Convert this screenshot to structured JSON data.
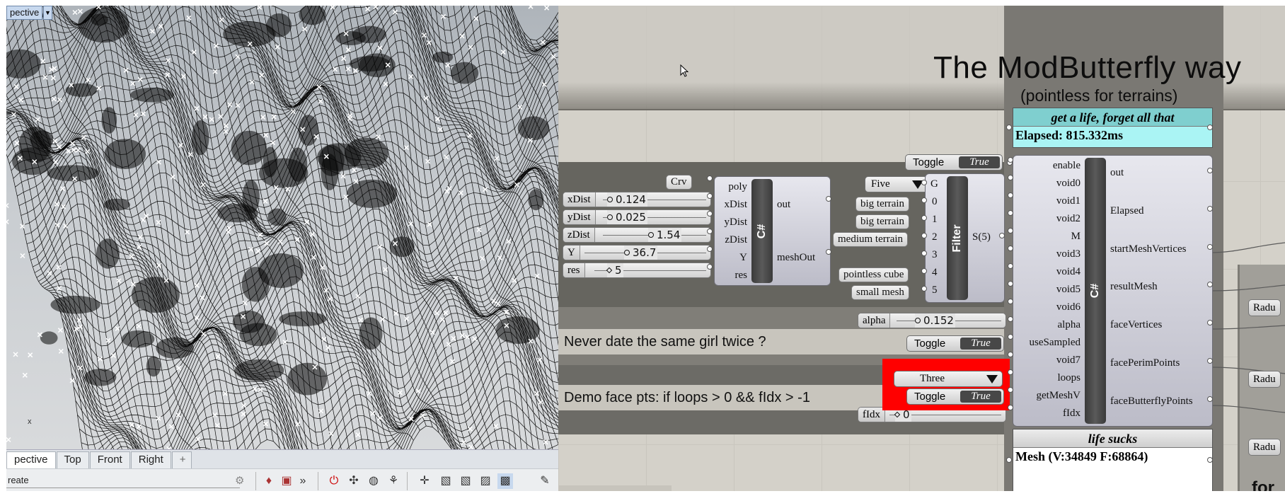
{
  "rhino": {
    "viewport_title": "pective",
    "tabs": [
      "pective",
      "Top",
      "Front",
      "Right"
    ],
    "tab_add_glyph": "+",
    "active_tab": "pective",
    "command_label": "reate",
    "axis_label": "x"
  },
  "grasshopper": {
    "title": "The ModButterfly way",
    "subtitle": "(pointless for terrains)",
    "notes": {
      "date": "Never date the same girl twice ?",
      "demo": "Demo face pts: if loops > 0 && fIdx > -1"
    },
    "crv_param": "Crv",
    "sliders": [
      {
        "name": "xDist",
        "value": "0.124"
      },
      {
        "name": "yDist",
        "value": "0.025"
      },
      {
        "name": "zDist",
        "value": "1.54"
      },
      {
        "name": "Y",
        "value": "36.7"
      },
      {
        "name": "res",
        "value": "5"
      },
      {
        "name": "alpha",
        "value": "0.152"
      },
      {
        "name": "fIdx",
        "value": "0"
      }
    ],
    "script1": {
      "inputs": [
        "poly",
        "xDist",
        "yDist",
        "zDist",
        "Y",
        "res"
      ],
      "outputs": [
        "out",
        "meshOut"
      ],
      "core": "C#"
    },
    "dropdown_five": "Five",
    "dropdown_three": "Three",
    "terrain_params": [
      "big terrain",
      "big terrain",
      "medium terrain",
      "pointless cube",
      "small mesh"
    ],
    "filter": {
      "core": "Filter",
      "inputs": [
        "G",
        "0",
        "1",
        "2",
        "3",
        "4",
        "5"
      ],
      "output": "S(5)"
    },
    "toggles": [
      {
        "label": "Toggle",
        "value": "True"
      },
      {
        "label": "Toggle",
        "value": "True"
      },
      {
        "label": "Toggle",
        "value": "True"
      }
    ],
    "panel_top": {
      "header": "get a life, forget all that",
      "body": "Elapsed: 815.332ms",
      "color": "#a9f2f2"
    },
    "script2": {
      "core": "C#",
      "inputs": [
        "enable",
        "void0",
        "void1",
        "void2",
        "M",
        "void3",
        "void4",
        "void5",
        "void6",
        "alpha",
        "useSampled",
        "void7",
        "loops",
        "getMeshV",
        "fIdx"
      ],
      "outputs": [
        "out",
        "Elapsed",
        "startMeshVertices",
        "resultMesh",
        "faceVertices",
        "facePerimPoints",
        "faceButterflyPoints"
      ]
    },
    "panel_bottom": {
      "header": "life sucks",
      "body": "Mesh (V:34849  F:68864)"
    },
    "radius_labels": [
      "Radu",
      "Radu",
      "Radu"
    ],
    "corner_text": "for",
    "highlight_color": "#ff0000"
  }
}
